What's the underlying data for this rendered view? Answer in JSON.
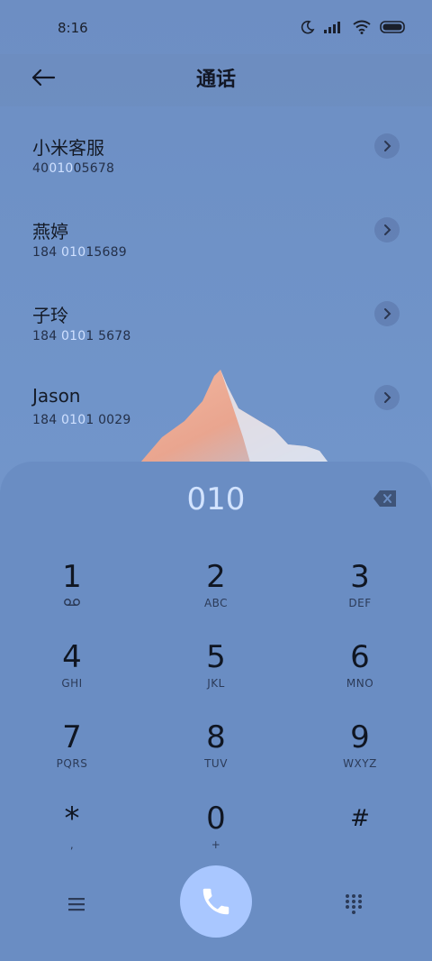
{
  "status_bar": {
    "time": "8:16",
    "icons": [
      "moon-icon",
      "signal-icon",
      "wifi-icon",
      "battery-icon"
    ]
  },
  "header": {
    "title": "通话",
    "back_icon": "back-arrow-icon"
  },
  "contacts": [
    {
      "name": "小米客服",
      "number_parts": [
        "40",
        "010",
        "05678"
      ]
    },
    {
      "name": "燕婷",
      "number_parts": [
        "184 ",
        "010",
        "15689"
      ]
    },
    {
      "name": "子玲",
      "number_parts": [
        "184 ",
        "010",
        "1 5678"
      ]
    },
    {
      "name": "Jason",
      "number_parts": [
        "184 ",
        "010",
        "1 0029"
      ]
    }
  ],
  "dialer": {
    "input": "010",
    "backspace_icon": "backspace-icon",
    "keys": [
      {
        "digit": "1",
        "letters": "voicemail-icon"
      },
      {
        "digit": "2",
        "letters": "ABC"
      },
      {
        "digit": "3",
        "letters": "DEF"
      },
      {
        "digit": "4",
        "letters": "GHI"
      },
      {
        "digit": "5",
        "letters": "JKL"
      },
      {
        "digit": "6",
        "letters": "MNO"
      },
      {
        "digit": "7",
        "letters": "PQRS"
      },
      {
        "digit": "8",
        "letters": "TUV"
      },
      {
        "digit": "9",
        "letters": "WXYZ"
      },
      {
        "digit": "*",
        "letters": ","
      },
      {
        "digit": "0",
        "letters": "+"
      },
      {
        "digit": "#",
        "letters": ""
      }
    ]
  },
  "bottom_bar": {
    "menu_icon": "menu-icon",
    "call_icon": "phone-icon",
    "keypad_icon": "keypad-icon"
  },
  "colors": {
    "background": "#7094c9",
    "dialpad": "#6a8dc3",
    "highlight": "#cfe0ff",
    "call_button": "#a9c7ff"
  }
}
